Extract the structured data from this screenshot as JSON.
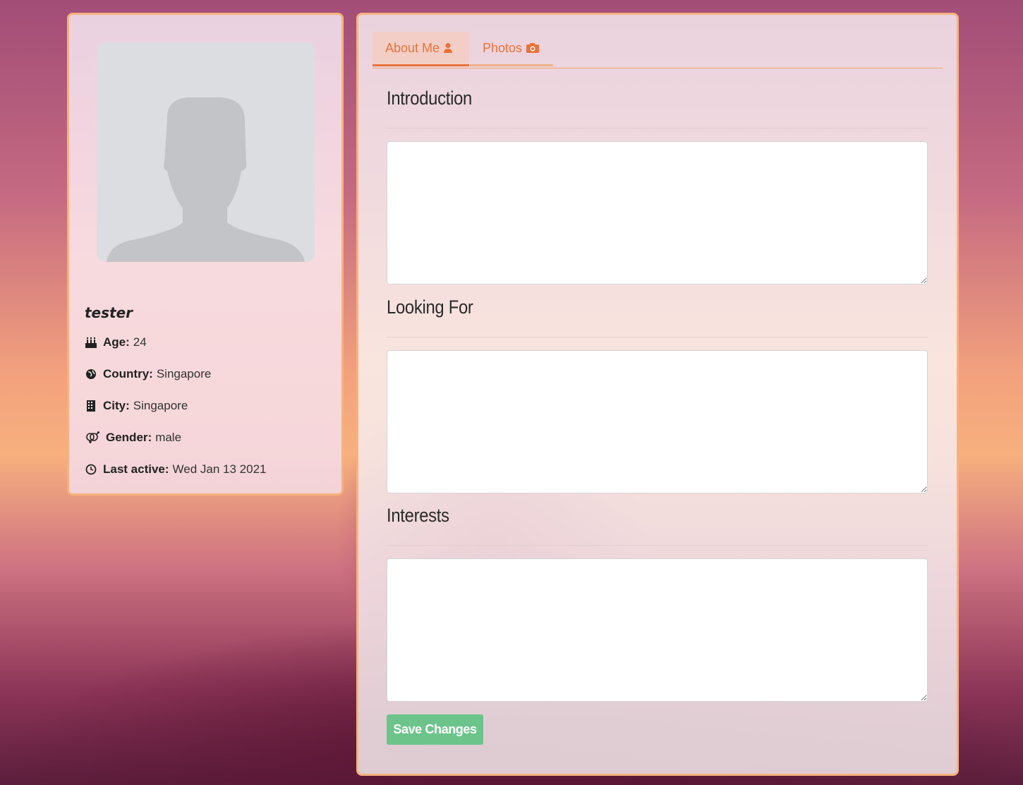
{
  "profile": {
    "username": "tester",
    "photo_alt": "person-silhouette",
    "age": {
      "label": "Age:",
      "value": "24",
      "icon": "birthday-cake-icon"
    },
    "country": {
      "label": "Country:",
      "value": "Singapore",
      "icon": "globe-icon"
    },
    "city": {
      "label": "City:",
      "value": "Singapore",
      "icon": "building-icon"
    },
    "gender": {
      "label": "Gender:",
      "value": "male",
      "icon": "gender-icon"
    },
    "last_active": {
      "label": "Last active:",
      "value": "Wed Jan 13 2021",
      "icon": "clock-icon"
    }
  },
  "tabs": [
    {
      "label": "About Me",
      "icon": "user-icon",
      "active": true
    },
    {
      "label": "Photos",
      "icon": "camera-icon",
      "active": false
    }
  ],
  "sections": {
    "introduction": {
      "title": "Introduction",
      "value": ""
    },
    "looking_for": {
      "title": "Looking For",
      "value": ""
    },
    "interests": {
      "title": "Interests",
      "value": ""
    }
  },
  "actions": {
    "save_label": "Save Changes"
  },
  "colors": {
    "accent": "#e8733a",
    "border": "#f6b27d",
    "save": "#6cc48b"
  }
}
